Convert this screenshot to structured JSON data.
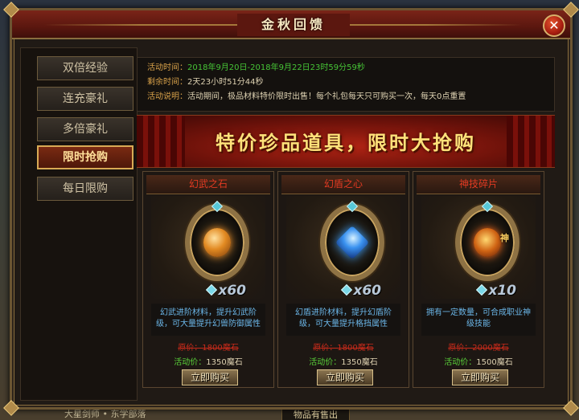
{
  "window": {
    "title": "金秋回馈",
    "close_symbol": "✕"
  },
  "sidebar": {
    "tabs": [
      {
        "label": "双倍经验"
      },
      {
        "label": "连充豪礼"
      },
      {
        "label": "多倍豪礼"
      },
      {
        "label": "限时抢购",
        "active": true
      },
      {
        "label": "每日限购"
      }
    ]
  },
  "info": {
    "time_label": "活动时间：",
    "time_value": "2018年9月20日-2018年9月22日23时59分59秒",
    "remain_label": "剩余时间：",
    "remain_value": "2天23小时51分44秒",
    "desc_label": "活动说明：",
    "desc_value": "活动期间，极品材料特价限时出售！每个礼包每天只可购买一次，每天0点重置"
  },
  "banner": {
    "text": "特价珍品道具，限时大抢购"
  },
  "cards": [
    {
      "name": "幻武之石",
      "quantity": "x60",
      "description": "幻武进阶材料，提升幻武阶级，可大量提升幻兽防御属性",
      "original_price": "原价：1800魔石",
      "event_price_label": "活动价：",
      "event_price_value": "1350魔石",
      "buy_label": "立即购买"
    },
    {
      "name": "幻盾之心",
      "quantity": "x60",
      "description": "幻盾进阶材料，提升幻盾阶级，可大量提升格挡属性",
      "original_price": "原价：1800魔石",
      "event_price_label": "活动价：",
      "event_price_value": "1350魔石",
      "buy_label": "立即购买"
    },
    {
      "name": "神技碎片",
      "quantity": "x10",
      "icon_mark": "神",
      "description": "拥有一定数量，可合成职业神级技能",
      "original_price": "原价：2000魔石",
      "event_price_label": "活动价：",
      "event_price_value": "1500魔石",
      "buy_label": "立即购买"
    }
  ],
  "background": {
    "left_text": "大星剑师 • 东学部落",
    "center_text": "物品有售出"
  },
  "colors": {
    "title_red": "#7a2418",
    "active_tab": "#d8aa55",
    "desc_blue": "#6bb6e8",
    "price_red": "#c62a1a",
    "price_green": "#5ad23a"
  }
}
